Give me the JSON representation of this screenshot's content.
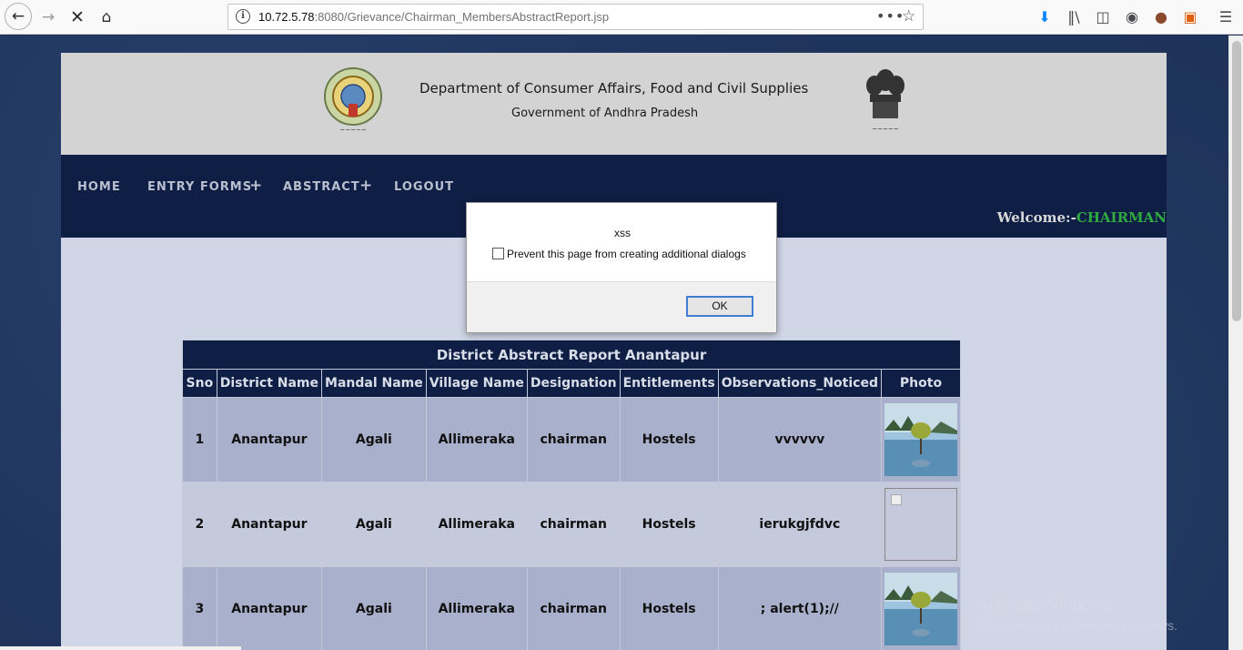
{
  "browser": {
    "url_host": "10.72.5.78",
    "url_rest": ":8080/Grievance/Chairman_MembersAbstractReport.jsp",
    "icons": [
      "back-arrow",
      "forward-arrow",
      "stop-x",
      "home",
      "info",
      "page-actions",
      "bookmark-star",
      "download",
      "library",
      "sidebar",
      "account",
      "cookie",
      "extension",
      "menu"
    ]
  },
  "header": {
    "dept_title": "Department of Consumer Affairs, Food and Civil Supplies",
    "gov_title": "Government of Andhra Pradesh"
  },
  "nav": {
    "home": "HOME",
    "entry_forms": "ENTRY FORMS",
    "abstract": "ABSTRACT",
    "logout": "LOGOUT",
    "plus": "+",
    "welcome_label": "Welcome:-",
    "welcome_name": "CHAIRMAN"
  },
  "report": {
    "title": "District Abstract Report Anantapur",
    "columns": [
      "Sno",
      "District Name",
      "Mandal Name",
      "Village Name",
      "Designation",
      "Entitlements",
      "Observations_Noticed",
      "Photo"
    ],
    "rows": [
      {
        "sno": "1",
        "district": "Anantapur",
        "mandal": "Agali",
        "village": "Allimeraka",
        "designation": "chairman",
        "entitlements": "Hostels",
        "observations": "vvvvvv",
        "photo": "lake-tree-image"
      },
      {
        "sno": "2",
        "district": "Anantapur",
        "mandal": "Agali",
        "village": "Allimeraka",
        "designation": "chairman",
        "entitlements": "Hostels",
        "observations": "ierukgjfdvc",
        "photo": "broken-image"
      },
      {
        "sno": "3",
        "district": "Anantapur",
        "mandal": "Agali",
        "village": "Allimeraka",
        "designation": "chairman",
        "entitlements": "Hostels",
        "observations": "; alert(1);//",
        "photo": "lake-tree-image"
      }
    ]
  },
  "dialog": {
    "message": "xss",
    "checkbox_label": "Prevent this page from creating additional dialogs",
    "checkbox_checked": false,
    "ok_label": "OK"
  },
  "watermark": {
    "line1": "Activate Windows",
    "line2": "Go to Settings to activate Windows."
  },
  "colors": {
    "nav_bg": "#0f1e45",
    "welcome_name": "#2faa3f",
    "row_odd": "#a8b0cb",
    "row_even": "#c4cadb"
  }
}
